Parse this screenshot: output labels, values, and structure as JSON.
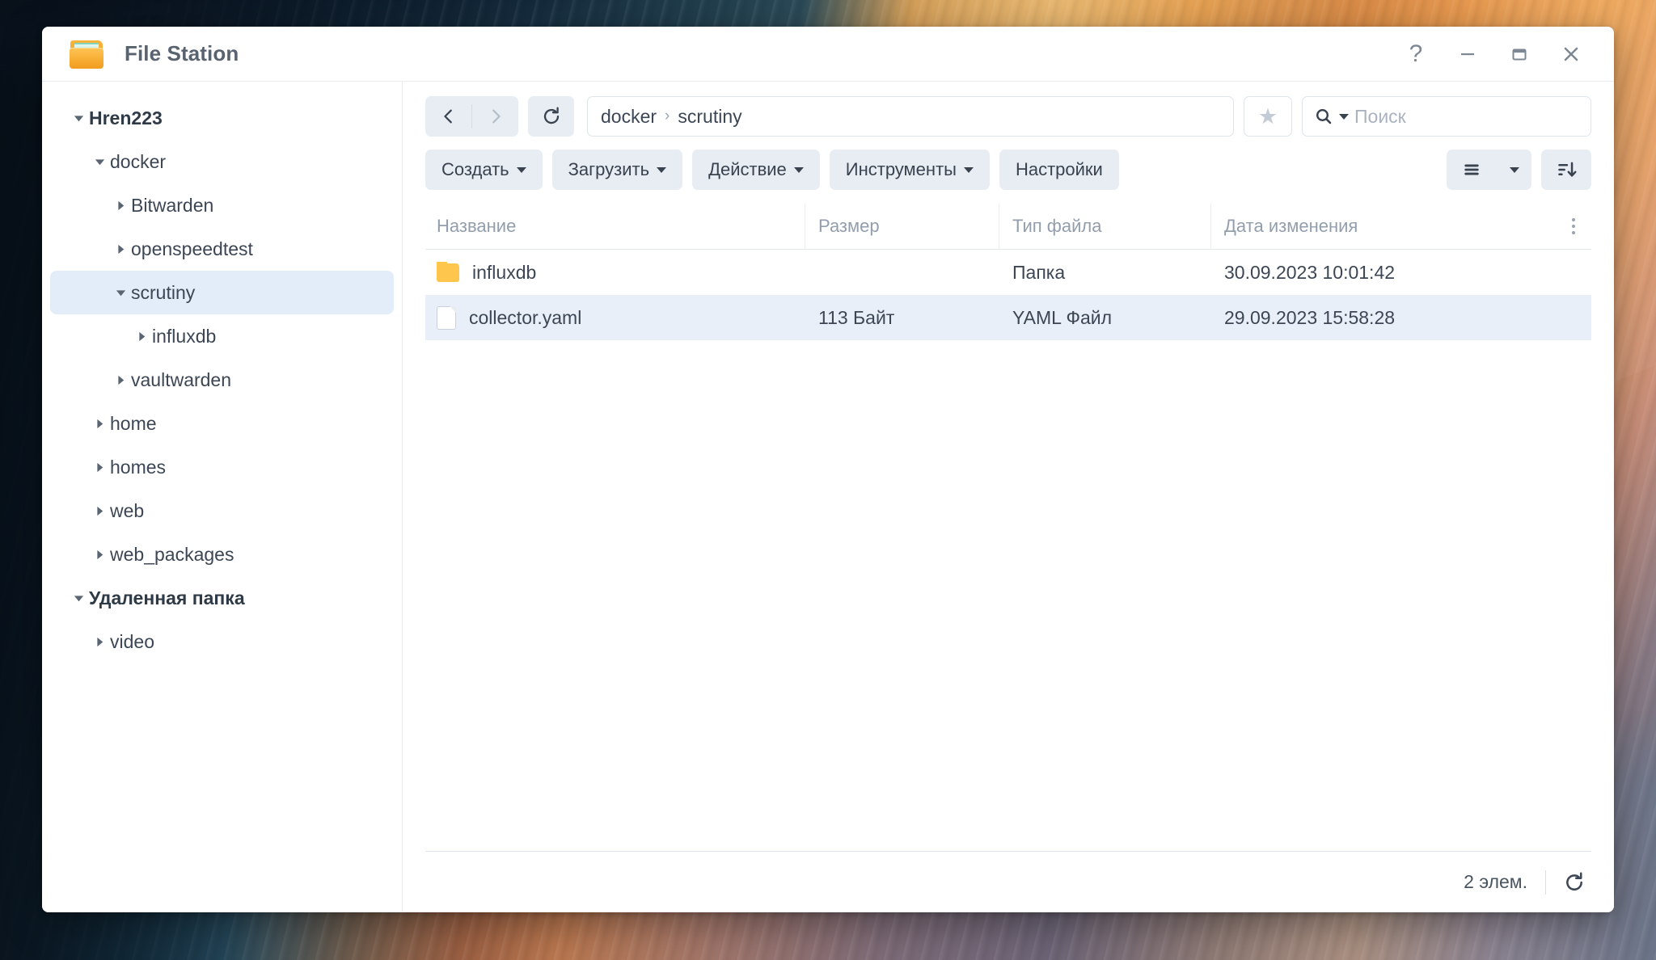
{
  "window": {
    "title": "File Station",
    "app_icon": "folder-icon",
    "controls": [
      {
        "name": "help",
        "glyph": "?"
      },
      {
        "name": "minimize",
        "glyph": "minimize-icon"
      },
      {
        "name": "maximize",
        "glyph": "maximize-icon"
      },
      {
        "name": "close",
        "glyph": "close-icon"
      }
    ]
  },
  "sidebar": {
    "items": [
      {
        "label": "Hren223",
        "depth": 0,
        "state": "expanded",
        "root": true,
        "selected": false
      },
      {
        "label": "docker",
        "depth": 1,
        "state": "expanded",
        "root": false,
        "selected": false
      },
      {
        "label": "Bitwarden",
        "depth": 2,
        "state": "collapsed",
        "root": false,
        "selected": false
      },
      {
        "label": "openspeedtest",
        "depth": 2,
        "state": "collapsed",
        "root": false,
        "selected": false
      },
      {
        "label": "scrutiny",
        "depth": 2,
        "state": "expanded",
        "root": false,
        "selected": true
      },
      {
        "label": "influxdb",
        "depth": 3,
        "state": "collapsed",
        "root": false,
        "selected": false
      },
      {
        "label": "vaultwarden",
        "depth": 2,
        "state": "collapsed",
        "root": false,
        "selected": false
      },
      {
        "label": "home",
        "depth": 1,
        "state": "collapsed",
        "root": false,
        "selected": false
      },
      {
        "label": "homes",
        "depth": 1,
        "state": "collapsed",
        "root": false,
        "selected": false
      },
      {
        "label": "web",
        "depth": 1,
        "state": "collapsed",
        "root": false,
        "selected": false
      },
      {
        "label": "web_packages",
        "depth": 1,
        "state": "collapsed",
        "root": false,
        "selected": false
      },
      {
        "label": "Удаленная папка",
        "depth": 0,
        "state": "expanded",
        "root": true,
        "selected": false
      },
      {
        "label": "video",
        "depth": 1,
        "state": "collapsed",
        "root": false,
        "selected": false
      }
    ]
  },
  "navbar": {
    "back_icon": "chevron-left-icon",
    "forward_icon": "chevron-right-icon",
    "forward_disabled": true,
    "refresh_icon": "refresh-icon",
    "breadcrumb": [
      "docker",
      "scrutiny"
    ],
    "breadcrumb_separator": "›",
    "favorite_icon": "star-icon",
    "search": {
      "placeholder": "Поиск",
      "value": "",
      "icon": "search-icon"
    }
  },
  "toolbar": {
    "buttons": [
      {
        "label": "Создать",
        "caret": true
      },
      {
        "label": "Загрузить",
        "caret": true
      },
      {
        "label": "Действие",
        "caret": true
      },
      {
        "label": "Инструменты",
        "caret": true
      },
      {
        "label": "Настройки",
        "caret": false
      }
    ],
    "view_icon": "list-view-icon",
    "view_caret_icon": "chevron-down-icon",
    "sort_icon": "sort-descending-icon"
  },
  "table": {
    "columns": [
      "Название",
      "Размер",
      "Тип файла",
      "Дата изменения"
    ],
    "options_icon": "more-vertical-icon",
    "rows": [
      {
        "icon": "folder-icon",
        "name": "influxdb",
        "size": "",
        "type": "Папка",
        "modified": "30.09.2023 10:01:42",
        "selected": false
      },
      {
        "icon": "file-icon",
        "name": "collector.yaml",
        "size": "113 Байт",
        "type": "YAML Файл",
        "modified": "29.09.2023 15:58:28",
        "selected": true
      }
    ]
  },
  "statusbar": {
    "item_count": "2 элем.",
    "refresh_icon": "refresh-icon"
  },
  "colors": {
    "selection": "#e8eff9",
    "tree_selection": "#e3edf9",
    "button_grey": "#e8edf3",
    "folder_yellow": "#ffc64d",
    "text": "#3c4654",
    "muted": "#939ead"
  }
}
